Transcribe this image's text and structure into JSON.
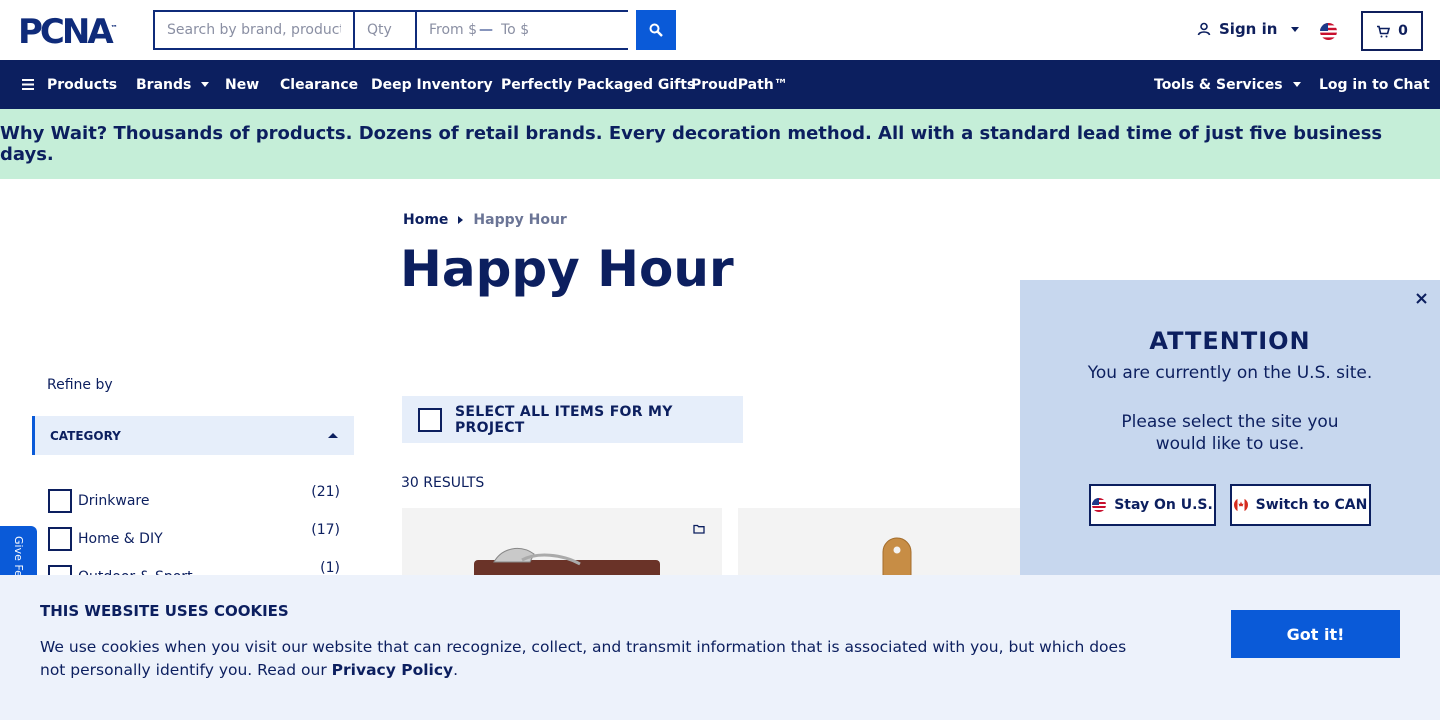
{
  "header": {
    "logo_text": "PCNA",
    "logo_tm": "™",
    "search_placeholder": "Search by brand, product or SKU",
    "qty_placeholder": "Qty",
    "from_placeholder": "From $",
    "range_dash": "—",
    "to_placeholder": "To $",
    "signin_label": "Sign in",
    "cart_count": "0"
  },
  "nav": {
    "products": "Products",
    "brands": "Brands",
    "new": "New",
    "clearance": "Clearance",
    "deep_inventory": "Deep Inventory",
    "gifts": "Perfectly Packaged Gifts",
    "proudpath": "ProudPath™",
    "tools": "Tools & Services",
    "chat": "Log in to Chat"
  },
  "promo_text": "Why Wait? Thousands of products. Dozens of retail brands. Every decoration method. All with a standard lead time of just five business days.",
  "breadcrumb": {
    "home": "Home",
    "current": "Happy Hour"
  },
  "page_title": "Happy Hour",
  "sidebar": {
    "refine_label": "Refine by",
    "category_header": "CATEGORY",
    "categories": [
      {
        "label": "Drinkware",
        "count": "(21)"
      },
      {
        "label": "Home & DIY",
        "count": "(17)"
      },
      {
        "label": "Outdoor & Sport",
        "count": "(1)"
      }
    ],
    "feedback_label": "Give Feedback"
  },
  "main": {
    "select_all_label": "SELECT ALL ITEMS FOR MY PROJECT",
    "results_label": "30 RESULTS"
  },
  "attention": {
    "title": "ATTENTION",
    "line1": "You are currently on the U.S. site.",
    "line2": "Please select the site you would like to use.",
    "stay_label": "Stay On U.S.",
    "switch_label": "Switch to CAN"
  },
  "cookie": {
    "title": "THIS WEBSITE USES COOKIES",
    "text": "We use cookies when you visit our website that can recognize, collect, and transmit information that is associated with you, but which does not personally identify you. Read our",
    "link": "Privacy Policy",
    "period": ".",
    "button": "Got it!"
  },
  "colors": {
    "navy": "#0c1f5f",
    "blue": "#0a5ad8",
    "promo_bg": "#c5eed8",
    "popup_bg": "#c7d7ee",
    "cookie_bg": "#edf2fb"
  }
}
